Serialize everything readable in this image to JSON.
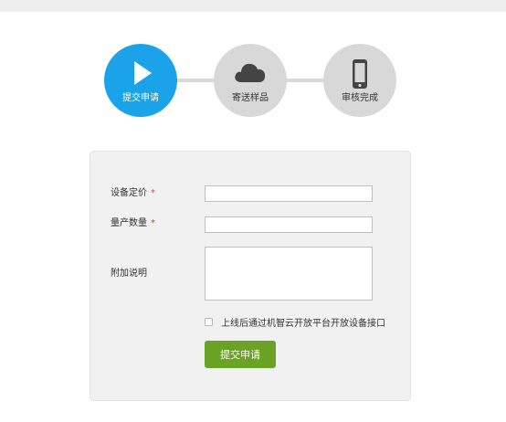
{
  "steps": [
    {
      "label": "提交申请",
      "icon": "play-icon",
      "active": true
    },
    {
      "label": "寄送样品",
      "icon": "cloud-icon",
      "active": false
    },
    {
      "label": "审核完成",
      "icon": "phone-icon",
      "active": false
    }
  ],
  "form": {
    "price_label": "设备定价",
    "price_value": "",
    "quantity_label": "量产数量",
    "quantity_value": "",
    "notes_label": "附加说明",
    "notes_value": "",
    "required_mark": "*",
    "checkbox_label": "上线后通过机智云开放平台开放设备接口",
    "checkbox_checked": false,
    "submit_label": "提交申请"
  },
  "colors": {
    "active_step": "#1aa3e8",
    "inactive_step": "#d8d8d8",
    "submit_button": "#6aa324",
    "required": "#e0453b",
    "panel_bg": "#f1f1f1"
  }
}
